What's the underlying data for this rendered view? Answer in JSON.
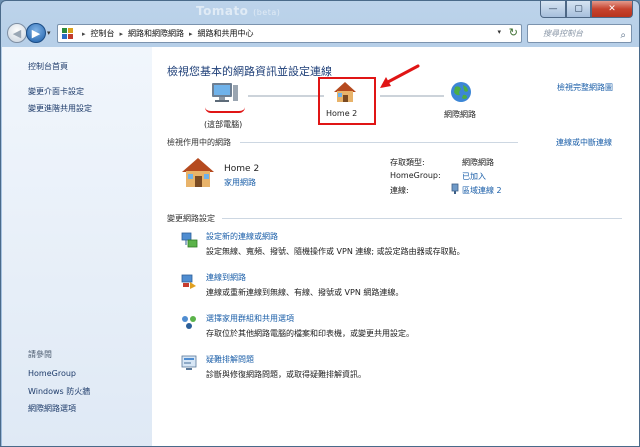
{
  "window": {
    "bg_title": "Tomato",
    "bg_title_suffix": "(beta)",
    "caption": {
      "min": "—",
      "max": "▢",
      "close": "✕"
    }
  },
  "nav": {
    "breadcrumbs": [
      "控制台",
      "網路和網際網路",
      "網路和共用中心"
    ],
    "search_placeholder": "搜尋控制台"
  },
  "sidebar": {
    "items": [
      "控制台首頁",
      "變更介面卡設定",
      "變更進階共用設定"
    ],
    "see_also_title": "請參閱",
    "see_also": [
      "HomeGroup",
      "Windows 防火牆",
      "網際網路選項"
    ]
  },
  "main": {
    "title": "檢視您基本的網路資訊並設定連線",
    "full_map_link": "檢視完整網路圖",
    "map": {
      "this_pc": "(這部電腦)",
      "network": "Home  2",
      "internet": "網際網路"
    },
    "active_section": {
      "label": "檢視作用中的網路",
      "connect_link": "連線或中斷連線",
      "network_name": "Home  2",
      "network_type": "家用網路",
      "access_type_label": "存取類型:",
      "access_type_value": "網際網路",
      "homegroup_label": "HomeGroup:",
      "homegroup_value": "已加入",
      "connection_label": "連線:",
      "connection_value": "區域連線 2"
    },
    "change_section": {
      "label": "變更網路設定",
      "tasks": [
        {
          "title": "設定新的連線或網路",
          "desc": "設定無線、寬頻、撥號、隨機操作或 VPN 連線; 或設定路由器或存取點。"
        },
        {
          "title": "連線到網路",
          "desc": "連線或重新連線到無線、有線、撥號或 VPN 網路連線。"
        },
        {
          "title": "選擇家用群組和共用選項",
          "desc": "存取位於其他網路電腦的檔案和印表機，或變更共用設定。"
        },
        {
          "title": "疑難排解問題",
          "desc": "診斷與修復網路問題，或取得疑難排解資訊。"
        }
      ]
    }
  },
  "colors": {
    "accent_link": "#1a5ea8",
    "title_text": "#1e3f78",
    "annotation_red": "#e01515"
  }
}
